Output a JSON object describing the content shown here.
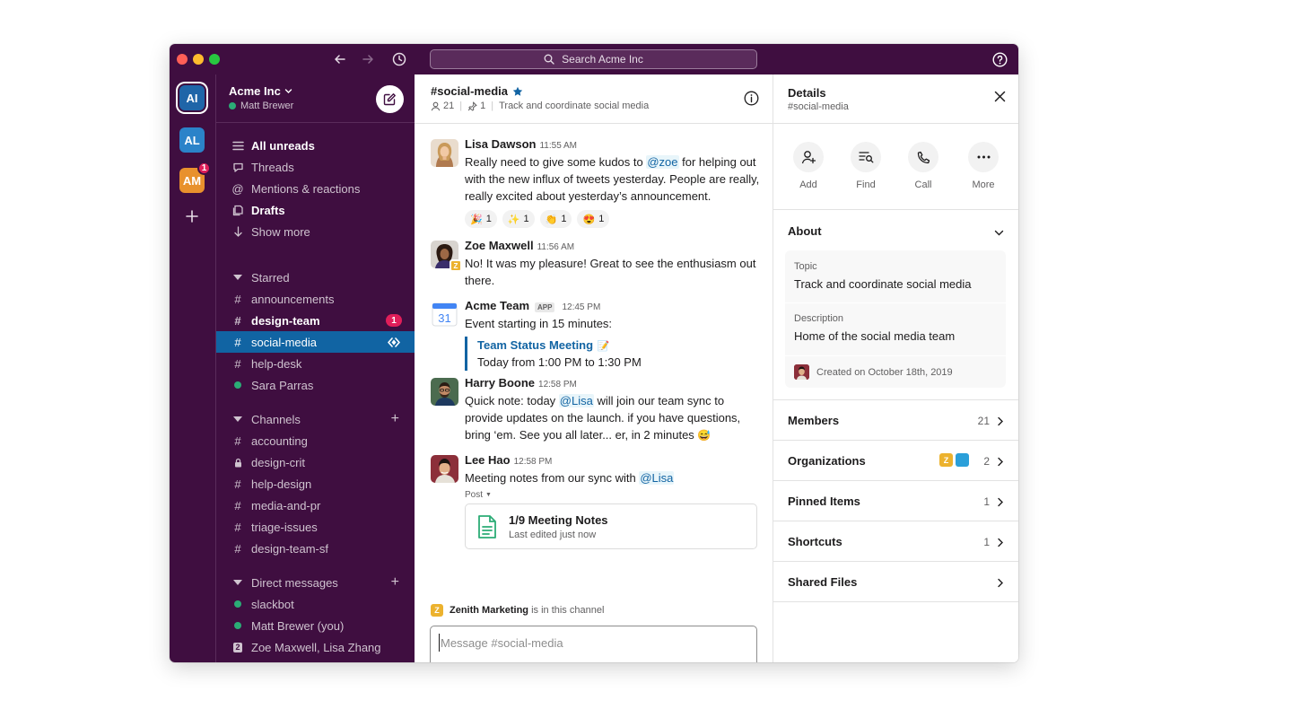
{
  "titlebar": {
    "search_label": "Search Acme Inc"
  },
  "rail": {
    "workspaces": [
      {
        "initials": "AI",
        "color": "#1f65a8"
      },
      {
        "initials": "AL",
        "color": "#2b83c9"
      },
      {
        "initials": "AM",
        "color": "#e8912d",
        "badge": "1"
      }
    ]
  },
  "sidebar": {
    "workspace_name": "Acme Inc",
    "user_name": "Matt Brewer",
    "nav": [
      {
        "label": "All unreads"
      },
      {
        "label": "Threads"
      },
      {
        "label": "Mentions & reactions"
      },
      {
        "label": "Drafts"
      },
      {
        "label": "Show more"
      }
    ],
    "starred": {
      "title": "Starred",
      "items": [
        {
          "label": "announcements"
        },
        {
          "label": "design-team",
          "badge": "1"
        },
        {
          "label": "social-media"
        },
        {
          "label": "help-desk"
        },
        {
          "label": "Sara Parras"
        }
      ]
    },
    "channels": {
      "title": "Channels",
      "items": [
        {
          "label": "accounting"
        },
        {
          "label": "design-crit"
        },
        {
          "label": "help-design"
        },
        {
          "label": "media-and-pr"
        },
        {
          "label": "triage-issues"
        },
        {
          "label": "design-team-sf"
        }
      ]
    },
    "dms": {
      "title": "Direct messages",
      "items": [
        {
          "label": "slackbot"
        },
        {
          "label": "Matt Brewer (you)"
        },
        {
          "label": "Zoe Maxwell, Lisa Zhang",
          "group_count": "2"
        }
      ]
    }
  },
  "channel": {
    "name": "#social-media",
    "member_count": "21",
    "pinned_count": "1",
    "topic": "Track and coordinate social media"
  },
  "messages": [
    {
      "author": "Lisa Dawson",
      "time": "11:55 AM",
      "text_1": "Really need to give some kudos to ",
      "mention": "@zoe",
      "text_2": " for helping out with the new influx of tweets yesterday. People are really, really excited about yesterday’s announcement.",
      "reactions": [
        {
          "emoji": "🎉",
          "count": "1"
        },
        {
          "emoji": "✨",
          "count": "1"
        },
        {
          "emoji": "👏",
          "count": "1"
        },
        {
          "emoji": "😍",
          "count": "1"
        }
      ]
    },
    {
      "author": "Zoe Maxwell",
      "time": "11:56 AM",
      "text": "No! It was my pleasure! Great to see the enthusiasm out there.",
      "org_badge": "Z"
    },
    {
      "author": "Acme Team",
      "app_tag": "APP",
      "time": "12:45 PM",
      "calendar_day": "31",
      "text": "Event starting in 15 minutes:",
      "event_title": "Team Status Meeting",
      "event_emoji": "📝",
      "event_time": "Today from 1:00 PM to 1:30 PM"
    },
    {
      "author": "Harry Boone",
      "time": "12:58 PM",
      "text_1": "Quick note: today ",
      "mention": "@Lisa",
      "text_2": " will join our team sync to provide updates on the launch. if you have questions, bring ‘em. See you all later... er, in 2 minutes ",
      "emoji": "😅"
    },
    {
      "author": "Lee Hao",
      "time": "12:58 PM",
      "text_1": "Meeting notes from our sync with ",
      "mention": "@Lisa",
      "post_label": "Post",
      "post_title": "1/9 Meeting Notes",
      "post_subtitle": "Last edited just now"
    }
  ],
  "join_notice": {
    "org_badge": "Z",
    "org": "Zenith Marketing",
    "text": " is in this channel"
  },
  "composer": {
    "placeholder": "Message #social-media",
    "value": ""
  },
  "details": {
    "title": "Details",
    "subtitle": "#social-media",
    "actions": [
      {
        "label": "Add"
      },
      {
        "label": "Find"
      },
      {
        "label": "Call"
      },
      {
        "label": "More"
      }
    ],
    "about_title": "About",
    "topic_label": "Topic",
    "topic_value": "Track and coordinate social media",
    "description_label": "Description",
    "description_value": "Home of the social media team",
    "created": "Created on October 18th, 2019",
    "rows": [
      {
        "name": "Members",
        "count": "21"
      },
      {
        "name": "Organizations",
        "count": "2",
        "badge": "Z"
      },
      {
        "name": "Pinned Items",
        "count": "1"
      },
      {
        "name": "Shortcuts",
        "count": "1"
      },
      {
        "name": "Shared Files",
        "count": ""
      }
    ]
  },
  "colors": {
    "aubergine": "#3f0e40",
    "active_channel": "#1164a3",
    "mention_badge": "#e01e5a",
    "presence": "#2bac76",
    "link": "#1264a3",
    "org_yellow": "#ecb22e",
    "org_blue": "#2b9fd9"
  }
}
